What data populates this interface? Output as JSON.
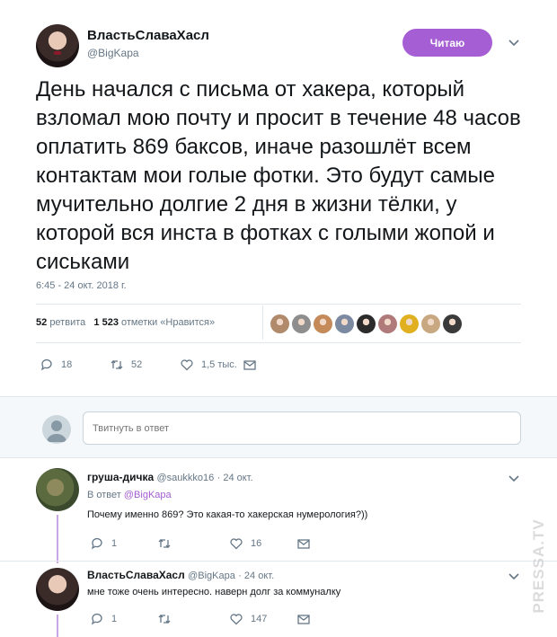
{
  "tweet": {
    "display_name": "ВластьСлаваХасл",
    "handle": "@BigKapa",
    "follow_label": "Читаю",
    "text": "День начался с письма от хакера, который взломал мою почту и просит в течение 48 часов оплатить 869 баксов, иначе разошлёт всем контактам мои голые фотки. Это будут самые мучительно долгие 2 дня в жизни тёлки, у которой вся инста в фотках с голыми жопой и сиськами",
    "timestamp": "6:45 - 24 окт. 2018 г.",
    "retweets_count": "52",
    "retweets_label": "ретвита",
    "likes_count": "1 523",
    "likes_label": "отметки «Нравится»",
    "actions": {
      "replies": "18",
      "retweets": "52",
      "likes": "1,5 тыс."
    }
  },
  "reply_box": {
    "placeholder": "Твитнуть в ответ"
  },
  "replies": [
    {
      "name": "груша-дичка",
      "handle": "@saukkko16",
      "date": "· 24 окт.",
      "in_reply_prefix": "В ответ ",
      "in_reply_handle": "@BigKapa",
      "text": "Почему именно 869? Это какая-то хакерская нумерология?))",
      "replies": "1",
      "likes": "16"
    },
    {
      "name": "ВластьСлаваХасл",
      "handle": "@BigKapa",
      "date": "· 24 окт.",
      "text": "мне тоже очень интересно. наверн долг за коммуналку",
      "replies": "1",
      "likes": "147"
    }
  ],
  "watermark": "PRESSA.TV",
  "colors": {
    "accent": "#a55ed4",
    "muted": "#657786",
    "text": "#14171a",
    "border": "#e1e8ed"
  },
  "liker_colors": [
    "#b08a6a",
    "#8e8e8e",
    "#c58a5a",
    "#7b8aa0",
    "#2b2b2b",
    "#b07a7a",
    "#e0b020",
    "#c8a880",
    "#3a3a3a"
  ]
}
